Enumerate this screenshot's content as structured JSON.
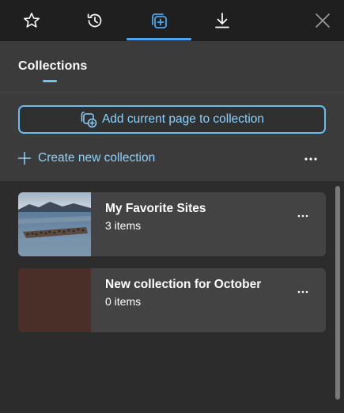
{
  "toolbar": {
    "buttons": [
      {
        "name": "favorites",
        "icon": "star-icon"
      },
      {
        "name": "history",
        "icon": "history-icon"
      },
      {
        "name": "collections",
        "icon": "collections-icon",
        "active": true
      },
      {
        "name": "downloads",
        "icon": "download-icon"
      },
      {
        "name": "close",
        "icon": "close-icon"
      }
    ],
    "accent_color": "#4aa6ee"
  },
  "collections": {
    "title": "Collections",
    "add_current_page_label": "Add current page to collection",
    "create_new_label": "Create new collection",
    "more_icon": "more-horizontal-icon",
    "items": [
      {
        "title": "My Favorite Sites",
        "count": "3 items",
        "thumbnail": "lake-with-birds-image"
      },
      {
        "title": "New collection for October",
        "count": "0 items",
        "thumbnail_color": "#4a2f28"
      }
    ]
  },
  "colors": {
    "link": "#8cd2ff",
    "panel_bg": "#3b3b3b",
    "toolbar_bg": "#1f1f1f",
    "list_bg": "#2c2c2c",
    "card_bg": "#434343"
  }
}
